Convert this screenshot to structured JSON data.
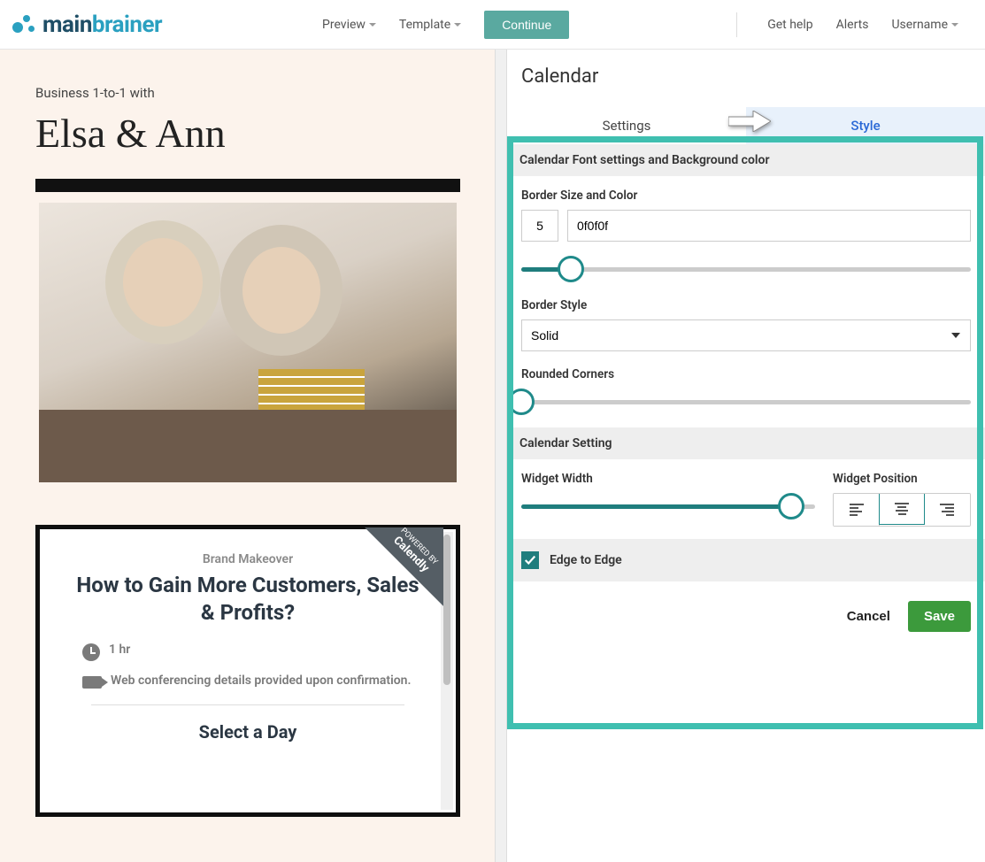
{
  "brand": {
    "name_main": "main",
    "name_accent": "brainer"
  },
  "nav": {
    "preview": "Preview",
    "template": "Template",
    "continue": "Continue",
    "gethelp": "Get help",
    "alerts": "Alerts",
    "username": "Username"
  },
  "canvas": {
    "label": "Business 1-to-1 with",
    "title": "Elsa & Ann",
    "calendly": {
      "powered": "POWERED BY",
      "brand": "Calendly",
      "subtitle": "Brand Makeover",
      "title": "How to Gain More Customers, Sales & Profits?",
      "duration": "1 hr",
      "location": "Web conferencing details provided upon confirmation.",
      "select_day": "Select a Day"
    }
  },
  "panel": {
    "title": "Calendar",
    "tabs": {
      "settings": "Settings",
      "style": "Style"
    },
    "sec_font": "Calendar Font settings and Background color",
    "border_label": "Border Size and Color",
    "border_size": "5",
    "border_color": "0f0f0f",
    "border_style_label": "Border Style",
    "border_style_value": "Solid",
    "rounded_label": "Rounded Corners",
    "sec_calendar": "Calendar Setting",
    "widget_width_label": "Widget Width",
    "widget_position_label": "Widget Position",
    "edge_to_edge": "Edge to Edge",
    "cancel": "Cancel",
    "save": "Save",
    "slider_border_pct": 11,
    "slider_rounded_pct": 0,
    "slider_width_pct": 92
  }
}
